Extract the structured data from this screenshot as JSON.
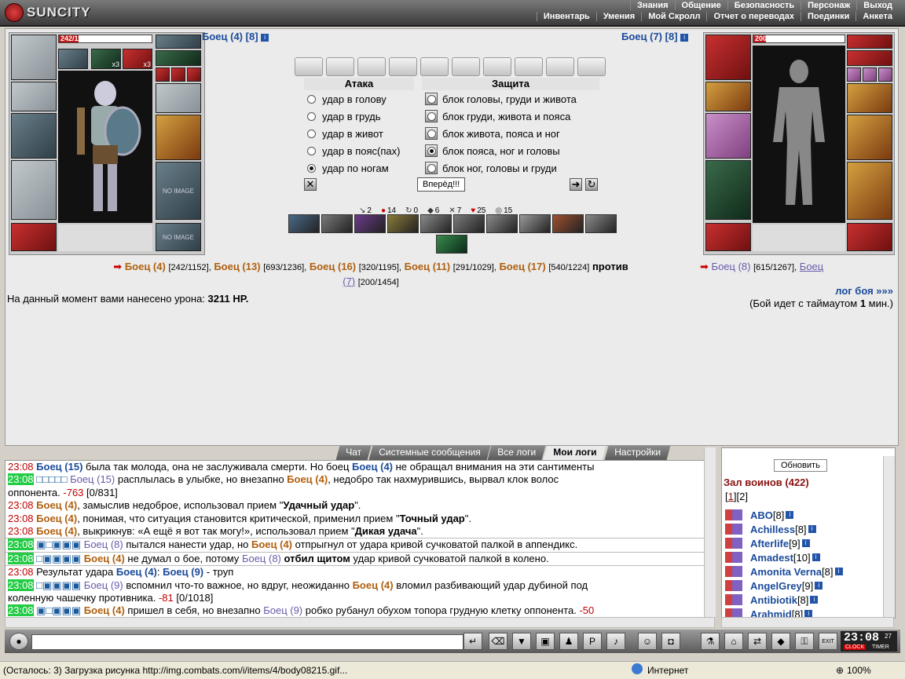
{
  "app": {
    "logo": "SUNCITY"
  },
  "menu_top": [
    "Знания",
    "Общение",
    "Безопасность",
    "Персонаж",
    "Выход"
  ],
  "menu_bottom": [
    "Инвентарь",
    "Умения",
    "Мой Скролл",
    "Отчет о переводах",
    "Поединки",
    "Анкета"
  ],
  "player_left": {
    "hp": "242/1152",
    "hp_fraction": 0.21,
    "name": "Боец (4)",
    "level": "[8]",
    "badge1": "x3",
    "badge2": "x3",
    "noimage": "NO IMAGE"
  },
  "player_right": {
    "hp": "200/1454",
    "hp_fraction": 0.14,
    "name": "Боец (7)",
    "level": "[8]"
  },
  "attack": {
    "attack_head": "Атака",
    "defense_head": "Защита",
    "attacks": [
      "удар в голову",
      "удар в грудь",
      "удар в живот",
      "удар в пояс(пах)",
      "удар по ногам"
    ],
    "attack_selected": 4,
    "blocks": [
      "блок головы, груди и живота",
      "блок груди, живота и пояса",
      "блок живота, пояса и ног",
      "блок пояса, ног и головы",
      "блок ног, головы и груди"
    ],
    "block_selected": 3,
    "go_button": "Вперёд!!!"
  },
  "stats": [
    "2",
    "14",
    "0",
    "6",
    "7",
    "25",
    "15"
  ],
  "teams": {
    "left": [
      {
        "name": "Боец (4)",
        "hp": "[242/1152],"
      },
      {
        "name": "Боец (13)",
        "hp": "[693/1236],"
      },
      {
        "name": "Боец (16)",
        "hp": "[320/1195],"
      },
      {
        "name": "Боец (11)",
        "hp": "[291/1029],"
      },
      {
        "name": "Боец (17)",
        "hp": "[540/1224]"
      }
    ],
    "versus": "против",
    "right": [
      {
        "name": "Боец (8)",
        "hp": "[615/1267],"
      },
      {
        "name": "Боец",
        "hp": ""
      }
    ],
    "right_wrap_name": "(7)",
    "right_wrap_hp": "[200/1454]"
  },
  "damage_text": "На данный момент вами нанесено урона:",
  "damage_value": "3211 HP.",
  "battle_log_link": "лог боя »»»",
  "timeout_text": "(Бой идет с таймаутом",
  "timeout_value": "1",
  "timeout_unit": "мин.)",
  "chat_tabs": [
    "Чат",
    "Системные сообщения",
    "Все логи",
    "Мои логи",
    "Настройки"
  ],
  "chat_active": 3,
  "log": [
    {
      "time": "23:08",
      "green": false,
      "parts": [
        [
          "n",
          "Боец (15)"
        ],
        [
          "t",
          " была так молода, она не заслуживала смерти. Но боец "
        ],
        [
          "n",
          "Боец (4)"
        ],
        [
          "t",
          " не обращал внимания на эти сантименты"
        ]
      ]
    },
    {
      "time": "23:08",
      "green": true,
      "parts": [
        [
          "p",
          "□□□□□"
        ],
        [
          "t",
          " "
        ],
        [
          "m",
          "Боец (15)"
        ],
        [
          "t",
          " расплылась в улыбке, но внезапно "
        ],
        [
          "b",
          "Боец (4)"
        ],
        [
          "t",
          ", недобро так нахмурившись, вырвал клок волос"
        ]
      ]
    },
    {
      "time": "",
      "green": false,
      "parts": [
        [
          "t",
          "оппонента. "
        ],
        [
          "d",
          "-763"
        ],
        [
          "t",
          " [0/831]"
        ]
      ]
    },
    {
      "time": "23:08",
      "green": false,
      "parts": [
        [
          "b",
          "Боец (4)"
        ],
        [
          "t",
          ", замыслив недоброе, использовал прием \""
        ],
        [
          "s",
          "Удачный удар"
        ],
        [
          "t",
          "\"."
        ]
      ]
    },
    {
      "time": "23:08",
      "green": false,
      "parts": [
        [
          "b",
          "Боец (4)"
        ],
        [
          "t",
          ", понимая, что ситуация становится критической, применил прием \""
        ],
        [
          "s",
          "Точный удар"
        ],
        [
          "t",
          "\"."
        ]
      ]
    },
    {
      "time": "23:08",
      "green": false,
      "parts": [
        [
          "b",
          "Боец (4)"
        ],
        [
          "t",
          ", выкрикнув: «А ещё я вот так могу!», использовал прием \""
        ],
        [
          "s",
          "Дикая удача"
        ],
        [
          "t",
          "\"."
        ]
      ]
    },
    {
      "time": "23:08",
      "green": true,
      "sep": true,
      "parts": [
        [
          "p",
          "▣□▣▣▣"
        ],
        [
          "t",
          " "
        ],
        [
          "m",
          "Боец (8)"
        ],
        [
          "t",
          " пытался нанести удар, но "
        ],
        [
          "b",
          "Боец (4)"
        ],
        [
          "t",
          " отпрыгнул от удара кривой сучковатой палкой в аппендикс."
        ]
      ]
    },
    {
      "time": "23:08",
      "green": true,
      "sep": true,
      "parts": [
        [
          "p",
          "□▣▣▣▣"
        ],
        [
          "t",
          " "
        ],
        [
          "b",
          "Боец (4)"
        ],
        [
          "t",
          " не думал о бое, потому "
        ],
        [
          "m",
          "Боец (8)"
        ],
        [
          "t",
          " "
        ],
        [
          "s",
          "отбил щитом"
        ],
        [
          "t",
          " удар кривой сучковатой палкой в колено."
        ]
      ]
    },
    {
      "time": "23:08",
      "green": false,
      "sep": true,
      "parts": [
        [
          "t",
          "Результат удара "
        ],
        [
          "n",
          "Боец (4)"
        ],
        [
          "t",
          ": "
        ],
        [
          "n",
          "Боец (9)"
        ],
        [
          "t",
          " - труп"
        ]
      ]
    },
    {
      "time": "23:08",
      "green": true,
      "parts": [
        [
          "p",
          "□▣▣▣▣"
        ],
        [
          "t",
          " "
        ],
        [
          "m",
          "Боец (9)"
        ],
        [
          "t",
          " вспомнил что-то важное, но вдруг, неожиданно "
        ],
        [
          "b",
          "Боец (4)"
        ],
        [
          "t",
          " вломил разбивающий удар дубиной под"
        ]
      ]
    },
    {
      "time": "",
      "green": false,
      "parts": [
        [
          "t",
          "коленную чашечку противника. "
        ],
        [
          "d",
          "-81"
        ],
        [
          "t",
          " [0/1018]"
        ]
      ]
    },
    {
      "time": "23:08",
      "green": true,
      "parts": [
        [
          "p",
          "▣□▣▣▣"
        ],
        [
          "t",
          " "
        ],
        [
          "b",
          "Боец (4)"
        ],
        [
          "t",
          " пришел в себя, но внезапно "
        ],
        [
          "m",
          "Боец (9)"
        ],
        [
          "t",
          " робко рубанул обухом топора грудную клетку оппонента. "
        ],
        [
          "d",
          "-50"
        ]
      ]
    }
  ],
  "warriors": {
    "refresh": "Обновить",
    "title": "Зал воинов (422)",
    "pages": [
      "1",
      "2"
    ],
    "list": [
      {
        "name": "ABO",
        "level": "[8]"
      },
      {
        "name": "Achilless",
        "level": "[8]"
      },
      {
        "name": "Afterlife",
        "level": "[9]"
      },
      {
        "name": "Amadest",
        "level": "[10]"
      },
      {
        "name": "Amonita Verna",
        "level": "[8]"
      },
      {
        "name": "AngelGrey",
        "level": "[9]"
      },
      {
        "name": "Antibiotik",
        "level": "[8]"
      },
      {
        "name": "Arahmid",
        "level": "[8]"
      }
    ]
  },
  "clock": {
    "time": "23:08",
    "seconds": "27",
    "label1": "CLOCK",
    "label2": "TIMER",
    "exit": "EXIT"
  },
  "status": {
    "text": "(Осталось: 3) Загрузка рисунка http://img.combats.com/i/items/4/body08215.gif...",
    "zone": "Интернет",
    "zoom": "100%"
  }
}
